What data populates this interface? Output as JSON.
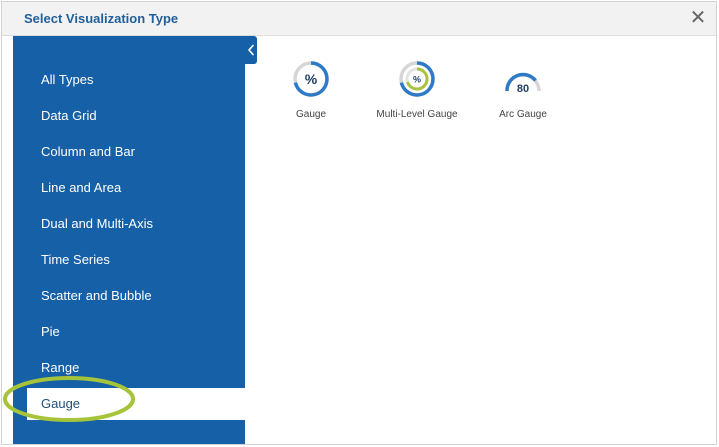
{
  "dialog": {
    "title": "Select Visualization Type",
    "close_glyph": "✕"
  },
  "sidebar": {
    "items": [
      {
        "label": "All Types"
      },
      {
        "label": "Data Grid"
      },
      {
        "label": "Column and Bar"
      },
      {
        "label": "Line and Area"
      },
      {
        "label": "Dual and Multi-Axis"
      },
      {
        "label": "Time Series"
      },
      {
        "label": "Scatter and Bubble"
      },
      {
        "label": "Pie"
      },
      {
        "label": "Range"
      },
      {
        "label": "Gauge",
        "selected": true
      }
    ],
    "collapse_icon": "chevron-left-icon"
  },
  "visualizations": [
    {
      "label": "Gauge",
      "icon": "gauge-icon",
      "icon_text": "%"
    },
    {
      "label": "Multi-Level Gauge",
      "icon": "multi-level-gauge-icon",
      "icon_text": "%"
    },
    {
      "label": "Arc Gauge",
      "icon": "arc-gauge-icon",
      "icon_text": "80"
    }
  ],
  "colors": {
    "sidebar_bg": "#1660a7",
    "accent_blue": "#2f7ac6",
    "gauge_green": "#a9c23f",
    "highlight_ring": "#a6c43a"
  }
}
